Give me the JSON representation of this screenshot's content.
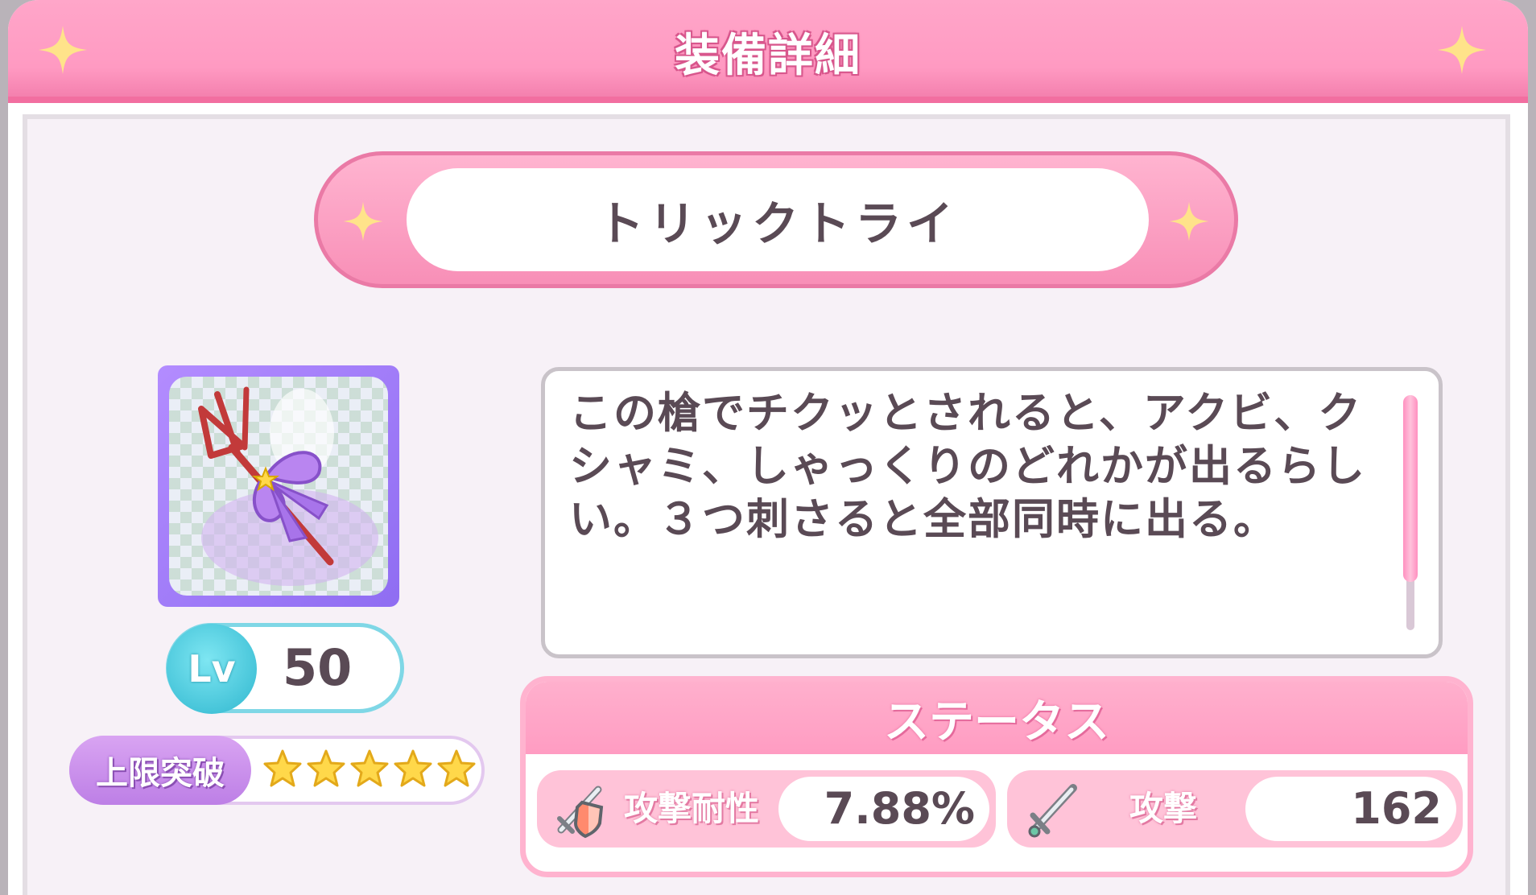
{
  "header": {
    "title": "装備詳細"
  },
  "equipment": {
    "name": "トリックトライ",
    "description": "この槍でチクッとされると、アクビ、クシャミ、しゃっくりのどれかが出るらしい。３つ刺さると全部同時に出る。",
    "level_label": "Lv",
    "level": "50",
    "limit_break_label": "上限突破",
    "limit_break_stars": 5
  },
  "status": {
    "title": "ステータス",
    "stats": [
      {
        "label": "攻撃耐性",
        "value": "7.88%",
        "icon": "shield-sword-icon"
      },
      {
        "label": "攻撃",
        "value": "162",
        "icon": "sword-icon"
      }
    ]
  },
  "colors": {
    "header_pink": "#ff9ac2",
    "accent_cyan": "#2fb7cf",
    "accent_purple": "#bd7fe6",
    "star_gold": "#ffd84a",
    "text_dark": "#5a4a55"
  }
}
